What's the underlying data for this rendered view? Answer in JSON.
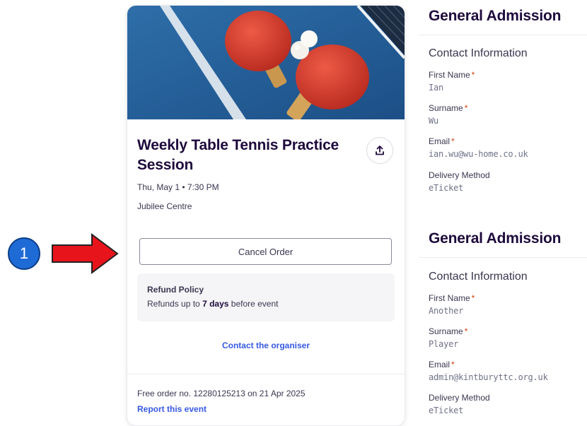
{
  "annotation": {
    "step": "1"
  },
  "event": {
    "title": "Weekly Table Tennis Practice Session",
    "date": "Thu, May 1 • 7:30 PM",
    "venue": "Jubilee Centre",
    "cancel_label": "Cancel Order",
    "refund_title": "Refund Policy",
    "refund_prefix": "Refunds up to",
    "refund_days": "7 days",
    "refund_suffix": "before event",
    "contact_label": "Contact the organiser",
    "order_text": "Free order no. 12280125213 on 21 Apr 2025",
    "report_label": "Report this event"
  },
  "tickets": [
    {
      "title": "General Admission",
      "section": "Contact Information",
      "fields": [
        {
          "label": "First Name",
          "required": "*",
          "value": "Ian"
        },
        {
          "label": "Surname",
          "required": "*",
          "value": "Wu"
        },
        {
          "label": "Email",
          "required": "*",
          "value": "ian.wu@wu-home.co.uk"
        },
        {
          "label": "Delivery Method",
          "value": "eTicket"
        }
      ]
    },
    {
      "title": "General Admission",
      "section": "Contact Information",
      "fields": [
        {
          "label": "First Name",
          "required": "*",
          "value": "Another"
        },
        {
          "label": "Surname",
          "required": "*",
          "value": "Player"
        },
        {
          "label": "Email",
          "required": "*",
          "value": "admin@kintburyttc.org.uk"
        },
        {
          "label": "Delivery Method",
          "value": "eTicket"
        }
      ]
    }
  ],
  "colors": {
    "brand_dark": "#1e0a3c",
    "link": "#3659e3",
    "required": "#d1410c",
    "annotation_arrow": "#e8141b",
    "annotation_badge": "#1f6bd6"
  }
}
